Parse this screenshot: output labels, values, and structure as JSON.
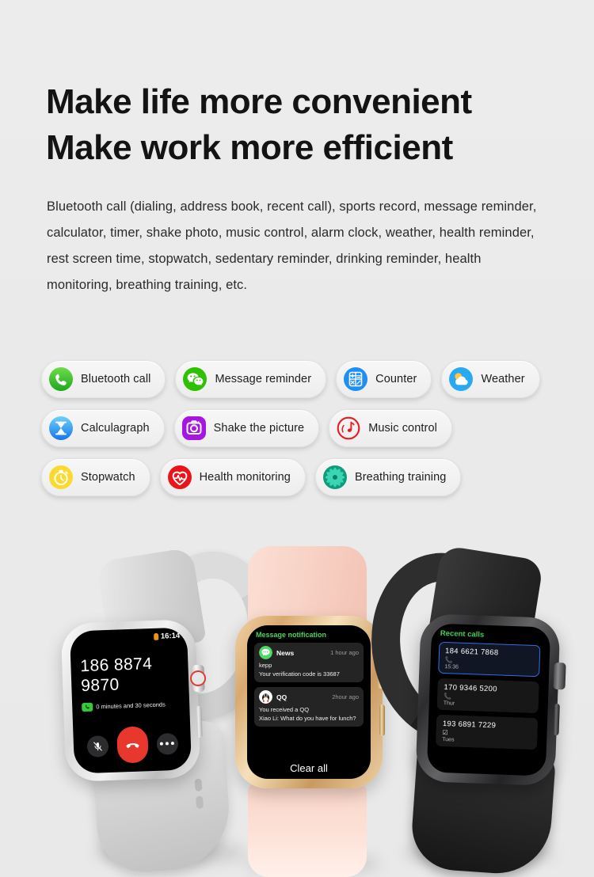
{
  "page": {
    "background_color": "#ebebeb"
  },
  "headline": {
    "line1": "Make life more convenient",
    "line2": "Make work more efficient"
  },
  "description": "Bluetooth call (dialing, address book, recent call), sports record, message reminder, calculator, timer, shake photo, music control, alarm clock, weather, health reminder, rest screen time, stopwatch, sedentary reminder, drinking reminder, health monitoring, breathing training, etc.",
  "feature_chips": {
    "rows": [
      [
        {
          "label": "Bluetooth call",
          "icon": "phone-icon",
          "color": "#3dbb3d"
        },
        {
          "label": "Message reminder",
          "icon": "wechat-icon",
          "color": "#2dc100"
        },
        {
          "label": "Counter",
          "icon": "calculator-icon",
          "color": "#1f8ff5"
        },
        {
          "label": "Weather",
          "icon": "sun-cloud-icon",
          "color": "#29a9f2"
        }
      ],
      [
        {
          "label": "Calculagraph",
          "icon": "hourglass-icon",
          "color": "#3aa7ef"
        },
        {
          "label": "Shake the picture",
          "icon": "camera-icon",
          "color": "#a516e0"
        },
        {
          "label": "Music control",
          "icon": "music-note-circle-icon",
          "color": "#e81b23"
        }
      ],
      [
        {
          "label": "Stopwatch",
          "icon": "stopwatch-icon",
          "color": "#fada31"
        },
        {
          "label": "Health monitoring",
          "icon": "heart-pulse-icon",
          "color": "#e8151c"
        },
        {
          "label": "Breathing training",
          "icon": "flower-mandala-icon",
          "color": "#14a98a"
        }
      ]
    ]
  },
  "watches": {
    "white": {
      "case_color": "#d9d9d9",
      "band_color": "#dcdcdc",
      "screen": {
        "status_time": "16:14",
        "phone_number": "186 8874 9870",
        "duration": "0 minutes and 30 seconds",
        "actions": [
          {
            "name": "mute-button",
            "icon": "microphone-muted-icon"
          },
          {
            "name": "end-call-button",
            "icon": "phone-down-icon"
          },
          {
            "name": "more-button",
            "icon": "ellipsis-icon"
          }
        ]
      }
    },
    "pink": {
      "case_color": "#d8a96f",
      "band_color": "#f9d4c7",
      "screen": {
        "title": "Message notification",
        "messages": [
          {
            "app": "News",
            "icon": "sms-bubble-icon",
            "time": "1 hour ago",
            "line1": "kepp",
            "line2": "Your verification code is 33687"
          },
          {
            "app": "QQ",
            "icon": "qq-penguin-icon",
            "time": "2hour ago",
            "line1": "You received a QQ",
            "line2": "Xiao Li: What do you have for lunch?"
          }
        ],
        "clear_all": "Clear all"
      }
    },
    "black": {
      "case_color": "#3a3a3c",
      "band_color": "#2a2a2a",
      "screen": {
        "title": "Recent calls",
        "highlight_color": "#2f6fe8",
        "calls": [
          {
            "number": "184 6621 7868",
            "icon": "phone-incoming-icon",
            "when": "15:36",
            "selected": true
          },
          {
            "number": "170 9346 5200",
            "icon": "phone-incoming-icon",
            "when": "Thur",
            "selected": false
          },
          {
            "number": "193 6891 7229",
            "icon": "phone-missed-icon",
            "when": "Tues",
            "selected": false
          }
        ]
      }
    }
  }
}
